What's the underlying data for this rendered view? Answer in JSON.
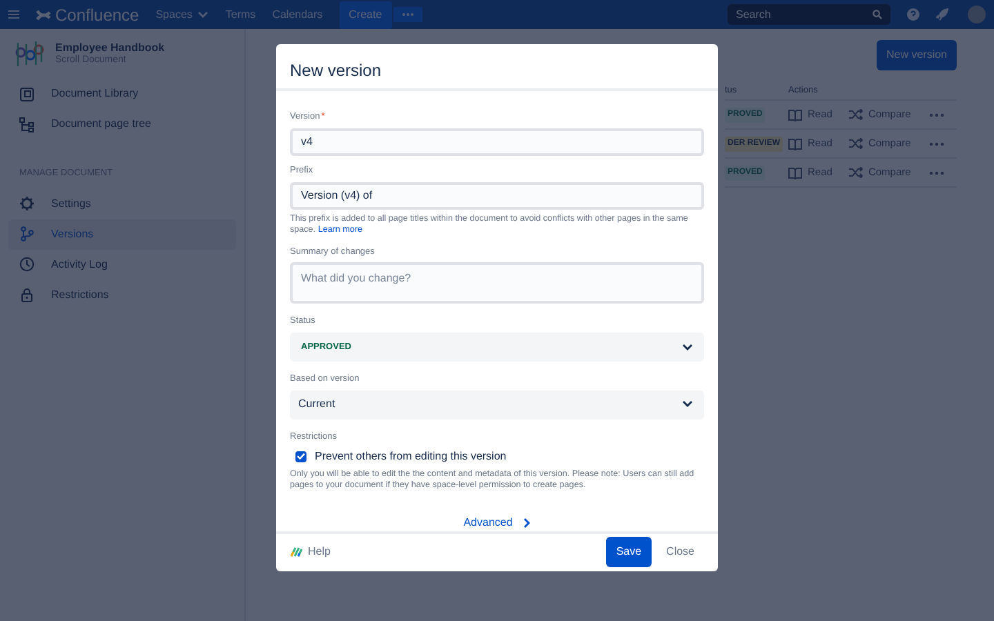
{
  "navbar": {
    "product": "Confluence",
    "links": [
      {
        "label": "Spaces",
        "dropdown": true
      },
      {
        "label": "Terms",
        "dropdown": false
      },
      {
        "label": "Calendars",
        "dropdown": false
      }
    ],
    "create": "Create",
    "search": {
      "placeholder": "Search"
    }
  },
  "sidebar": {
    "document": {
      "title": "Employee Handbook",
      "subtitle": "Scroll Document"
    },
    "items": [
      {
        "label": "Document Library",
        "kind": "library",
        "selected": false
      },
      {
        "label": "Document page tree",
        "kind": "tree",
        "selected": false
      }
    ],
    "section": "MANAGE DOCUMENT",
    "manage_items": [
      {
        "label": "Settings",
        "kind": "gear",
        "selected": false
      },
      {
        "label": "Versions",
        "kind": "branch",
        "selected": true
      },
      {
        "label": "Activity Log",
        "kind": "clock",
        "selected": false
      },
      {
        "label": "Restrictions",
        "kind": "lock",
        "selected": false
      }
    ]
  },
  "main": {
    "new_version_button": "New version",
    "table": {
      "columns": [
        "tus",
        "Actions"
      ],
      "rows": [
        {
          "status": "PROVED",
          "kind": "approved",
          "read": "Read",
          "compare": "Compare"
        },
        {
          "status": "DER REVIEW",
          "kind": "review",
          "read": "Read",
          "compare": "Compare"
        },
        {
          "status": "PROVED",
          "kind": "approved",
          "read": "Read",
          "compare": "Compare"
        }
      ]
    }
  },
  "dialog": {
    "title": "New version",
    "version": {
      "label": "Version",
      "required_mark": "*",
      "value": "v4"
    },
    "prefix": {
      "label": "Prefix",
      "value": "Version (v4) of",
      "help": "This prefix is added to all page titles within the document to avoid conflicts with other pages in the same space.",
      "link": "Learn more"
    },
    "summary": {
      "label": "Summary of changes",
      "placeholder": "What did you change?"
    },
    "status": {
      "label": "Status",
      "value": "APPROVED",
      "kind": "approved"
    },
    "based_on": {
      "label": "Based on version",
      "value": "Current"
    },
    "restrictions": {
      "label": "Restrictions",
      "checkbox": "Prevent others from editing this version",
      "checked": true,
      "note": "Only you will be able to edit the the content and metadata of this version. Please note: Users can still add pages to your document if they have space-level permission to create pages."
    },
    "advanced": "Advanced",
    "footer": {
      "help": "Help",
      "save": "Save",
      "close": "Close"
    }
  }
}
